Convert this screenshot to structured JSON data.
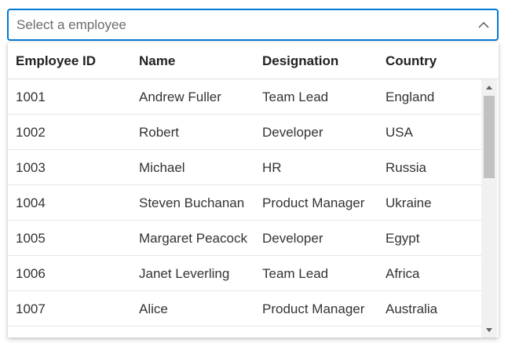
{
  "combo": {
    "placeholder": "Select a employee",
    "value": ""
  },
  "icons": {
    "toggle": "chevron-up-icon",
    "scroll_up": "triangle-up-icon",
    "scroll_down": "triangle-down-icon"
  },
  "colors": {
    "focus_border": "#0078d4",
    "header_text": "#212121",
    "cell_text": "#333333",
    "row_divider": "#e6e6e6",
    "scroll_track": "#f1f1f1",
    "scroll_thumb": "#c1c1c1"
  },
  "grid": {
    "headers": [
      "Employee ID",
      "Name",
      "Designation",
      "Country"
    ],
    "rows": [
      [
        "1001",
        "Andrew Fuller",
        "Team Lead",
        "England"
      ],
      [
        "1002",
        "Robert",
        "Developer",
        "USA"
      ],
      [
        "1003",
        "Michael",
        "HR",
        "Russia"
      ],
      [
        "1004",
        "Steven Buchanan",
        "Product Manager",
        "Ukraine"
      ],
      [
        "1005",
        "Margaret Peacock",
        "Developer",
        "Egypt"
      ],
      [
        "1006",
        "Janet Leverling",
        "Team Lead",
        "Africa"
      ],
      [
        "1007",
        "Alice",
        "Product Manager",
        "Australia"
      ]
    ]
  }
}
